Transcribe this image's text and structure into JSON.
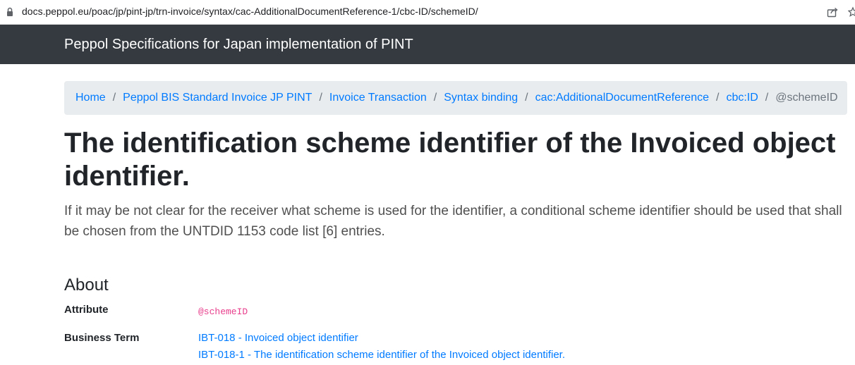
{
  "browser": {
    "url": "docs.peppol.eu/poac/jp/pint-jp/trn-invoice/syntax/cac-AdditionalDocumentReference-1/cbc-ID/schemeID/",
    "icons": [
      "lock-icon",
      "share-icon",
      "star-icon"
    ]
  },
  "navbar": {
    "brand": "Peppol Specifications for Japan implementation of PINT",
    "background": "#343a40"
  },
  "breadcrumb": {
    "separator": "/",
    "items": [
      "Home",
      "Peppol BIS Standard Invoice JP PINT",
      "Invoice Transaction",
      "Syntax binding",
      "cac:AdditionalDocumentReference",
      "cbc:ID"
    ],
    "active": "@schemeID"
  },
  "page": {
    "title": "The identification scheme identifier of the Invoiced object identifier.",
    "lead": "If it may be not clear for the receiver what scheme is used for the identifier, a conditional scheme identifier should be used that shall be chosen from the UNTDID 1153 code list [6] entries."
  },
  "about": {
    "title": "About",
    "attribute_label": "Attribute",
    "attribute_value": "@schemeID",
    "business_term_label": "Business Term",
    "business_terms": [
      "IBT-018 - Invoiced object identifier",
      "IBT-018-1 - The identification scheme identifier of the Invoiced object identifier."
    ]
  },
  "colors": {
    "link": "#007bff",
    "code": "#e83e8c",
    "breadcrumb_bg": "#e9ecef"
  }
}
